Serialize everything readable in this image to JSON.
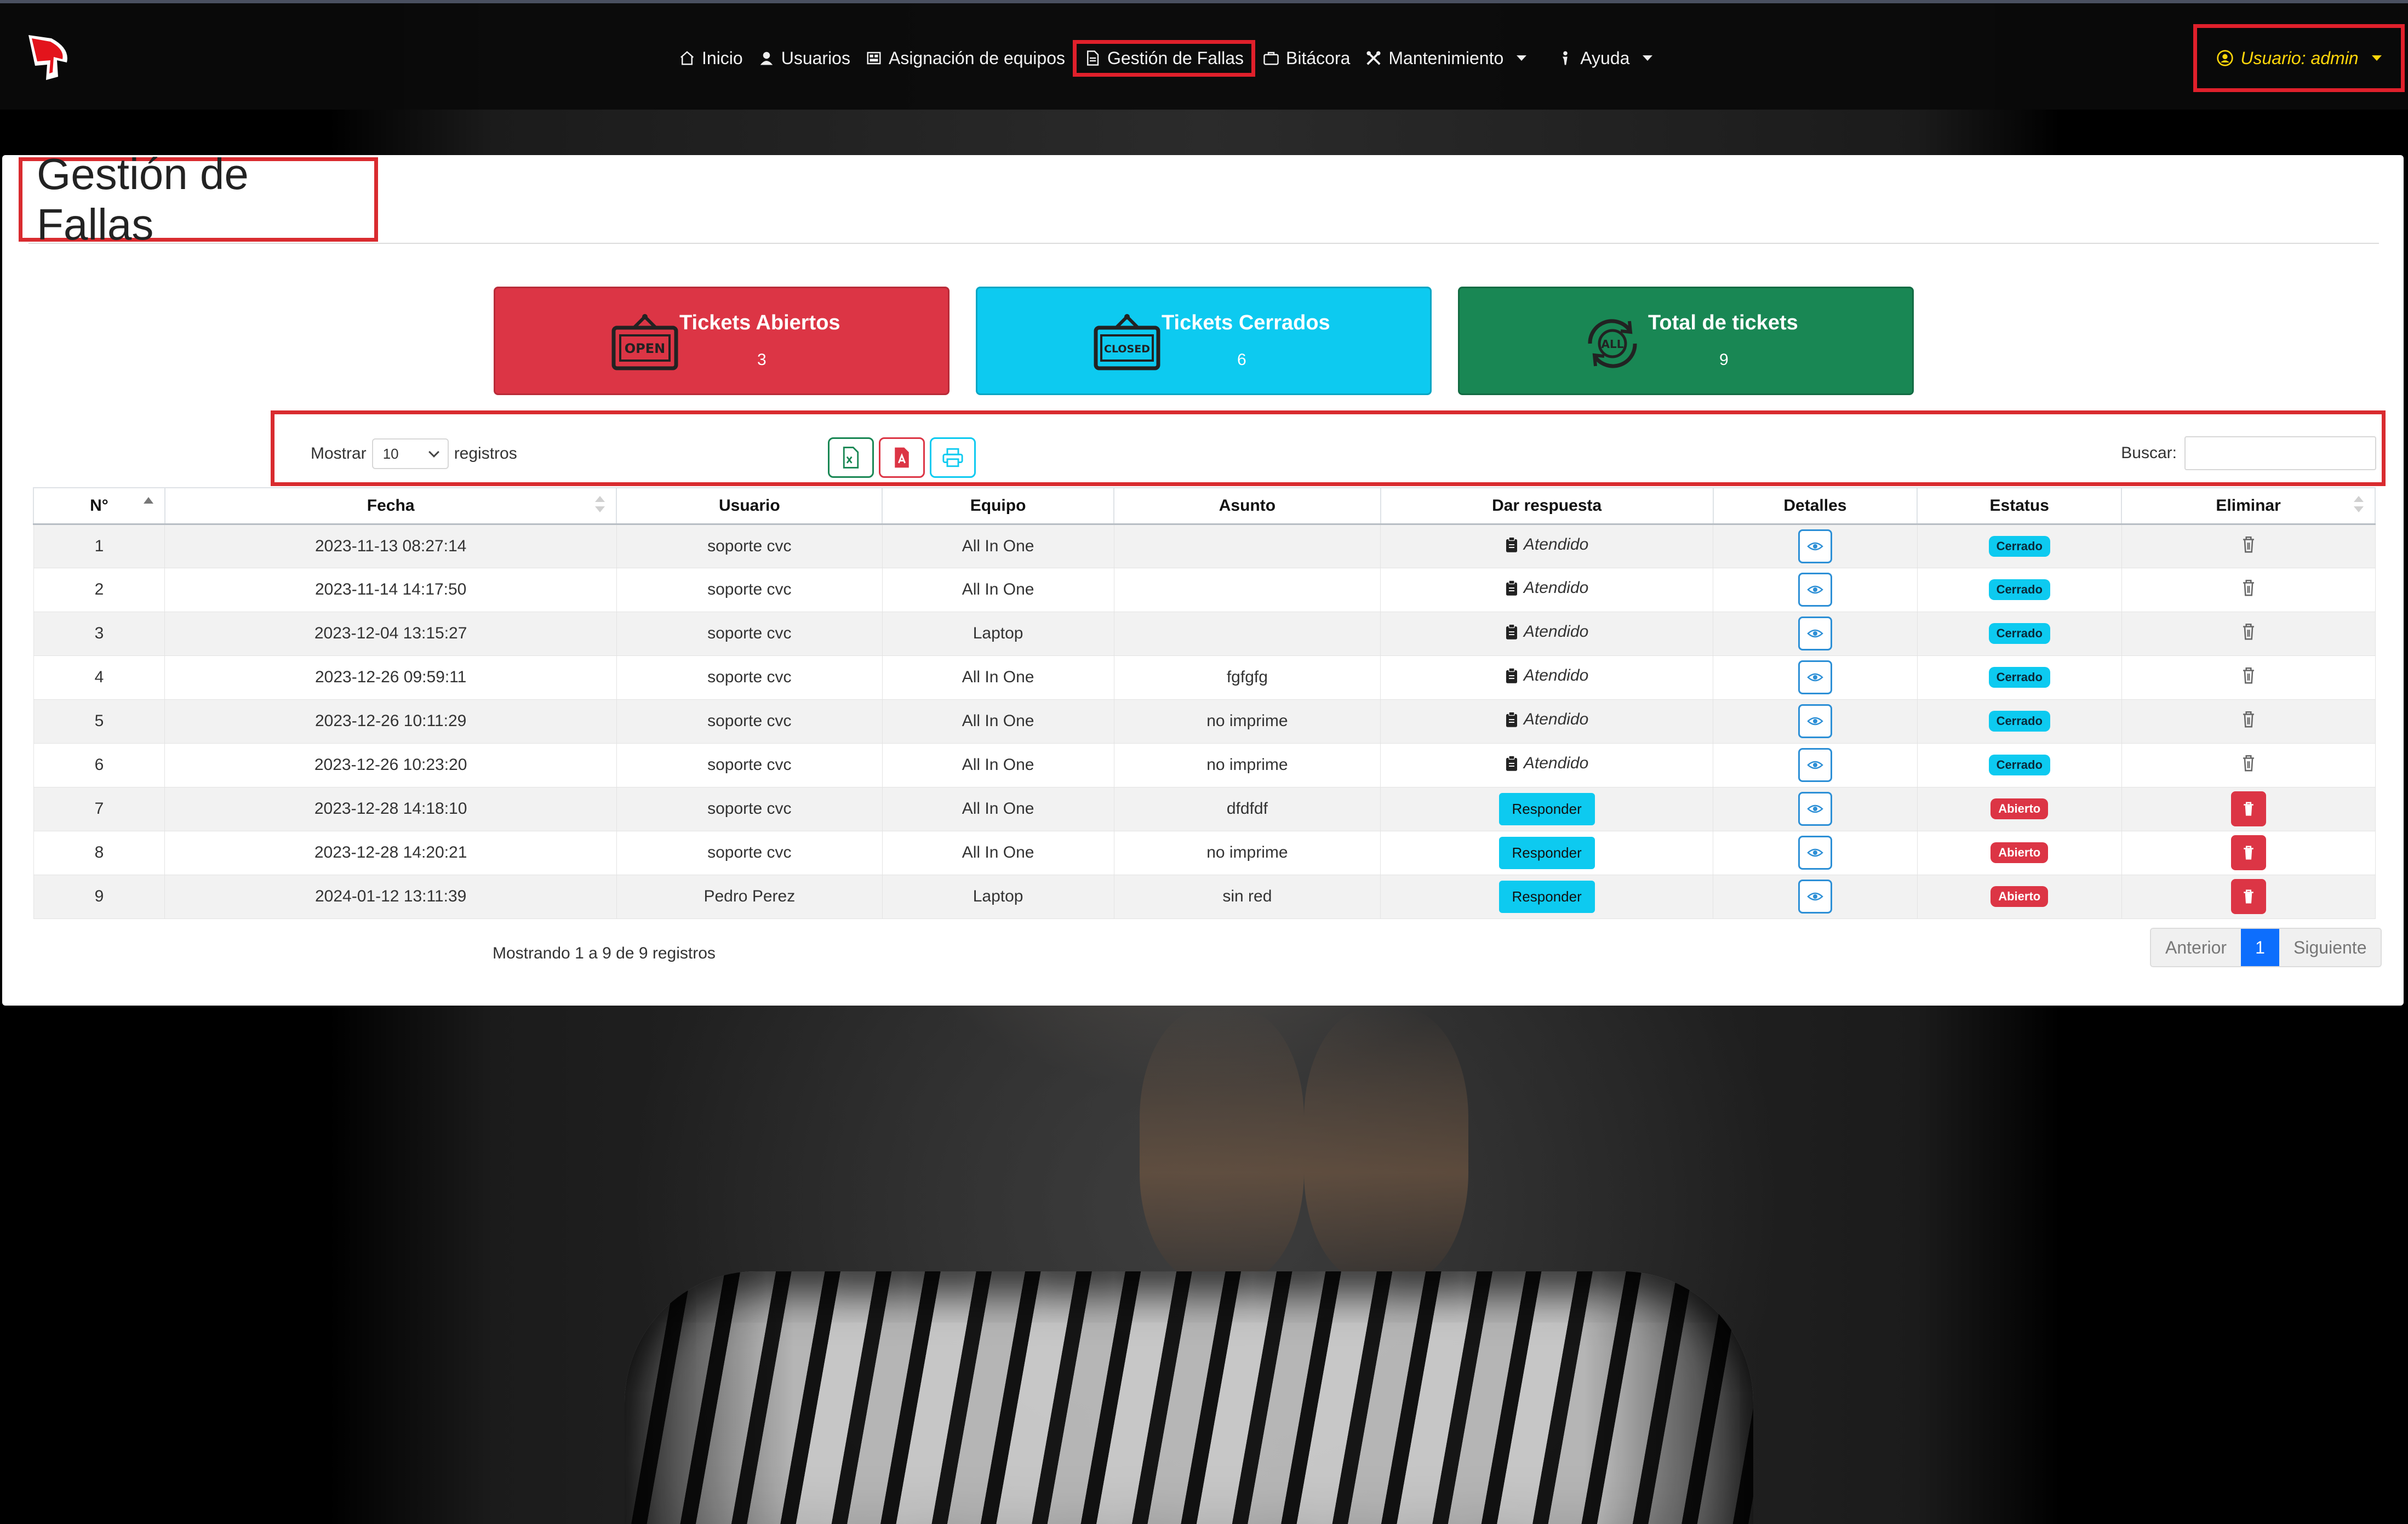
{
  "navbar": {
    "items": [
      {
        "label": "Inicio",
        "icon": "home-icon"
      },
      {
        "label": "Usuarios",
        "icon": "user-icon"
      },
      {
        "label": "Asignación de equipos",
        "icon": "equipment-icon"
      },
      {
        "label": "Gestión de Fallas",
        "icon": "document-icon",
        "active": true
      },
      {
        "label": "Bitácora",
        "icon": "briefcase-icon"
      },
      {
        "label": "Mantenimiento",
        "icon": "tools-icon",
        "dropdown": true
      },
      {
        "label": "Ayuda",
        "icon": "help-icon",
        "dropdown": true
      }
    ],
    "user_label": "Usuario: admin"
  },
  "page": {
    "title": "Gestión de Fallas"
  },
  "stats": {
    "open": {
      "title": "Tickets Abiertos",
      "count": "3",
      "icon_text": "OPEN"
    },
    "closed": {
      "title": "Tickets Cerrados",
      "count": "6",
      "icon_text": "CLOSED"
    },
    "total": {
      "title": "Total de tickets",
      "count": "9",
      "icon_text": "ALL"
    }
  },
  "controls": {
    "show_label": "Mostrar",
    "page_size": "10",
    "records_label": "registros",
    "search_label": "Buscar:"
  },
  "table": {
    "headers": [
      "N°",
      "Fecha",
      "Usuario",
      "Equipo",
      "Asunto",
      "Dar respuesta",
      "Detalles",
      "Estatus",
      "Eliminar"
    ],
    "attended_label": "Atendido",
    "respond_label": "Responder",
    "rows": [
      {
        "n": "1",
        "fecha": "2023-11-13 08:27:14",
        "usuario": "soporte cvc",
        "equipo": "All In One",
        "asunto": "",
        "estatus": "Cerrado"
      },
      {
        "n": "2",
        "fecha": "2023-11-14 14:17:50",
        "usuario": "soporte cvc",
        "equipo": "All In One",
        "asunto": "",
        "estatus": "Cerrado"
      },
      {
        "n": "3",
        "fecha": "2023-12-04 13:15:27",
        "usuario": "soporte cvc",
        "equipo": "Laptop",
        "asunto": "",
        "estatus": "Cerrado"
      },
      {
        "n": "4",
        "fecha": "2023-12-26 09:59:11",
        "usuario": "soporte cvc",
        "equipo": "All In One",
        "asunto": "fgfgfg",
        "estatus": "Cerrado"
      },
      {
        "n": "5",
        "fecha": "2023-12-26 10:11:29",
        "usuario": "soporte cvc",
        "equipo": "All In One",
        "asunto": "no imprime",
        "estatus": "Cerrado"
      },
      {
        "n": "6",
        "fecha": "2023-12-26 10:23:20",
        "usuario": "soporte cvc",
        "equipo": "All In One",
        "asunto": "no imprime",
        "estatus": "Cerrado"
      },
      {
        "n": "7",
        "fecha": "2023-12-28 14:18:10",
        "usuario": "soporte cvc",
        "equipo": "All In One",
        "asunto": "dfdfdf",
        "estatus": "Abierto"
      },
      {
        "n": "8",
        "fecha": "2023-12-28 14:20:21",
        "usuario": "soporte cvc",
        "equipo": "All In One",
        "asunto": "no imprime",
        "estatus": "Abierto"
      },
      {
        "n": "9",
        "fecha": "2024-01-12 13:11:39",
        "usuario": "Pedro Perez",
        "equipo": "Laptop",
        "asunto": "sin red",
        "estatus": "Abierto"
      }
    ]
  },
  "footer": {
    "info": "Mostrando 1 a 9 de 9 registros",
    "prev": "Anterior",
    "current_page": "1",
    "next": "Siguiente"
  },
  "colors": {
    "open": "#dc3545",
    "closed": "#0dcaf0",
    "total": "#198754",
    "highlight": "#d92b2f",
    "user_accent": "#ffd60a"
  }
}
